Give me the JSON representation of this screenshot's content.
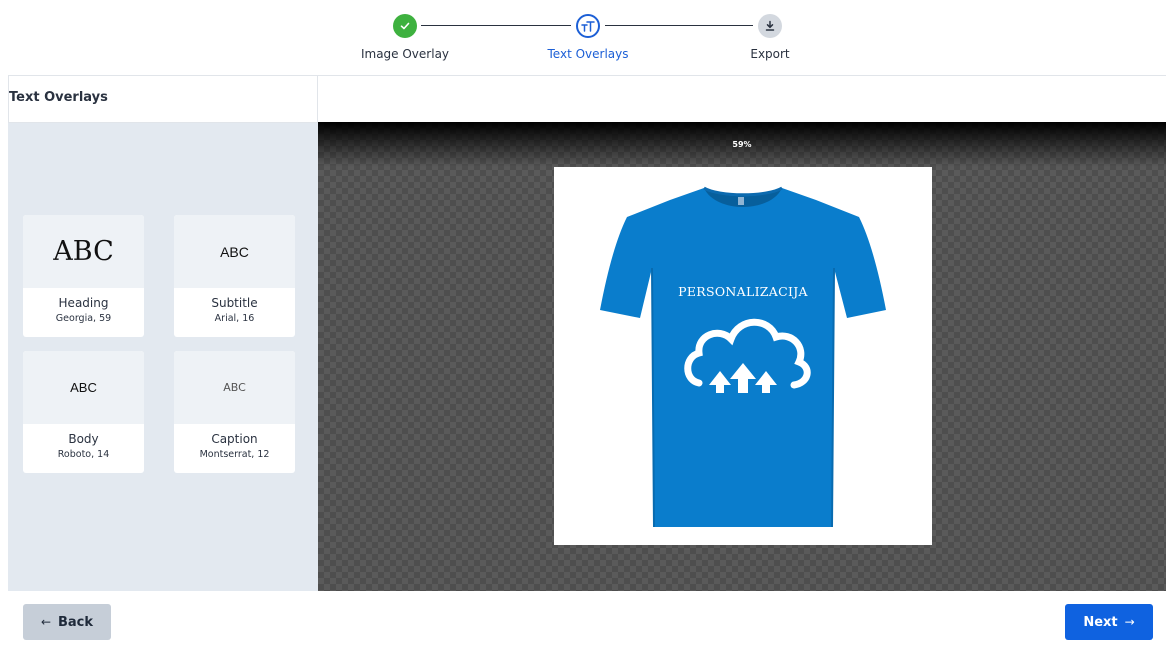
{
  "stepper": {
    "steps": [
      {
        "label": "Image Overlay",
        "state": "completed",
        "icon": "check-icon"
      },
      {
        "label": "Text Overlays",
        "state": "active",
        "icon": "text-size-icon"
      },
      {
        "label": "Export",
        "state": "pending",
        "icon": "download-icon"
      }
    ]
  },
  "sidebar": {
    "title": "Text Overlays",
    "presets": [
      {
        "preview": "ABC",
        "name": "Heading",
        "font": "Georgia, 59"
      },
      {
        "preview": "ABC",
        "name": "Subtitle",
        "font": "Arial, 16"
      },
      {
        "preview": "ABC",
        "name": "Body",
        "font": "Roboto, 14"
      },
      {
        "preview": "ABC",
        "name": "Caption",
        "font": "Montserrat, 12"
      }
    ]
  },
  "canvas": {
    "zoom": "59%",
    "overlay_text": "PERSONALIZACIJA",
    "shirt_color": "#0a7dcc"
  },
  "footer": {
    "back_label": "Back",
    "next_label": "Next"
  },
  "colors": {
    "accent": "#0f62e0",
    "success": "#3eb13f",
    "sidebar_bg": "#e3e9f0"
  }
}
